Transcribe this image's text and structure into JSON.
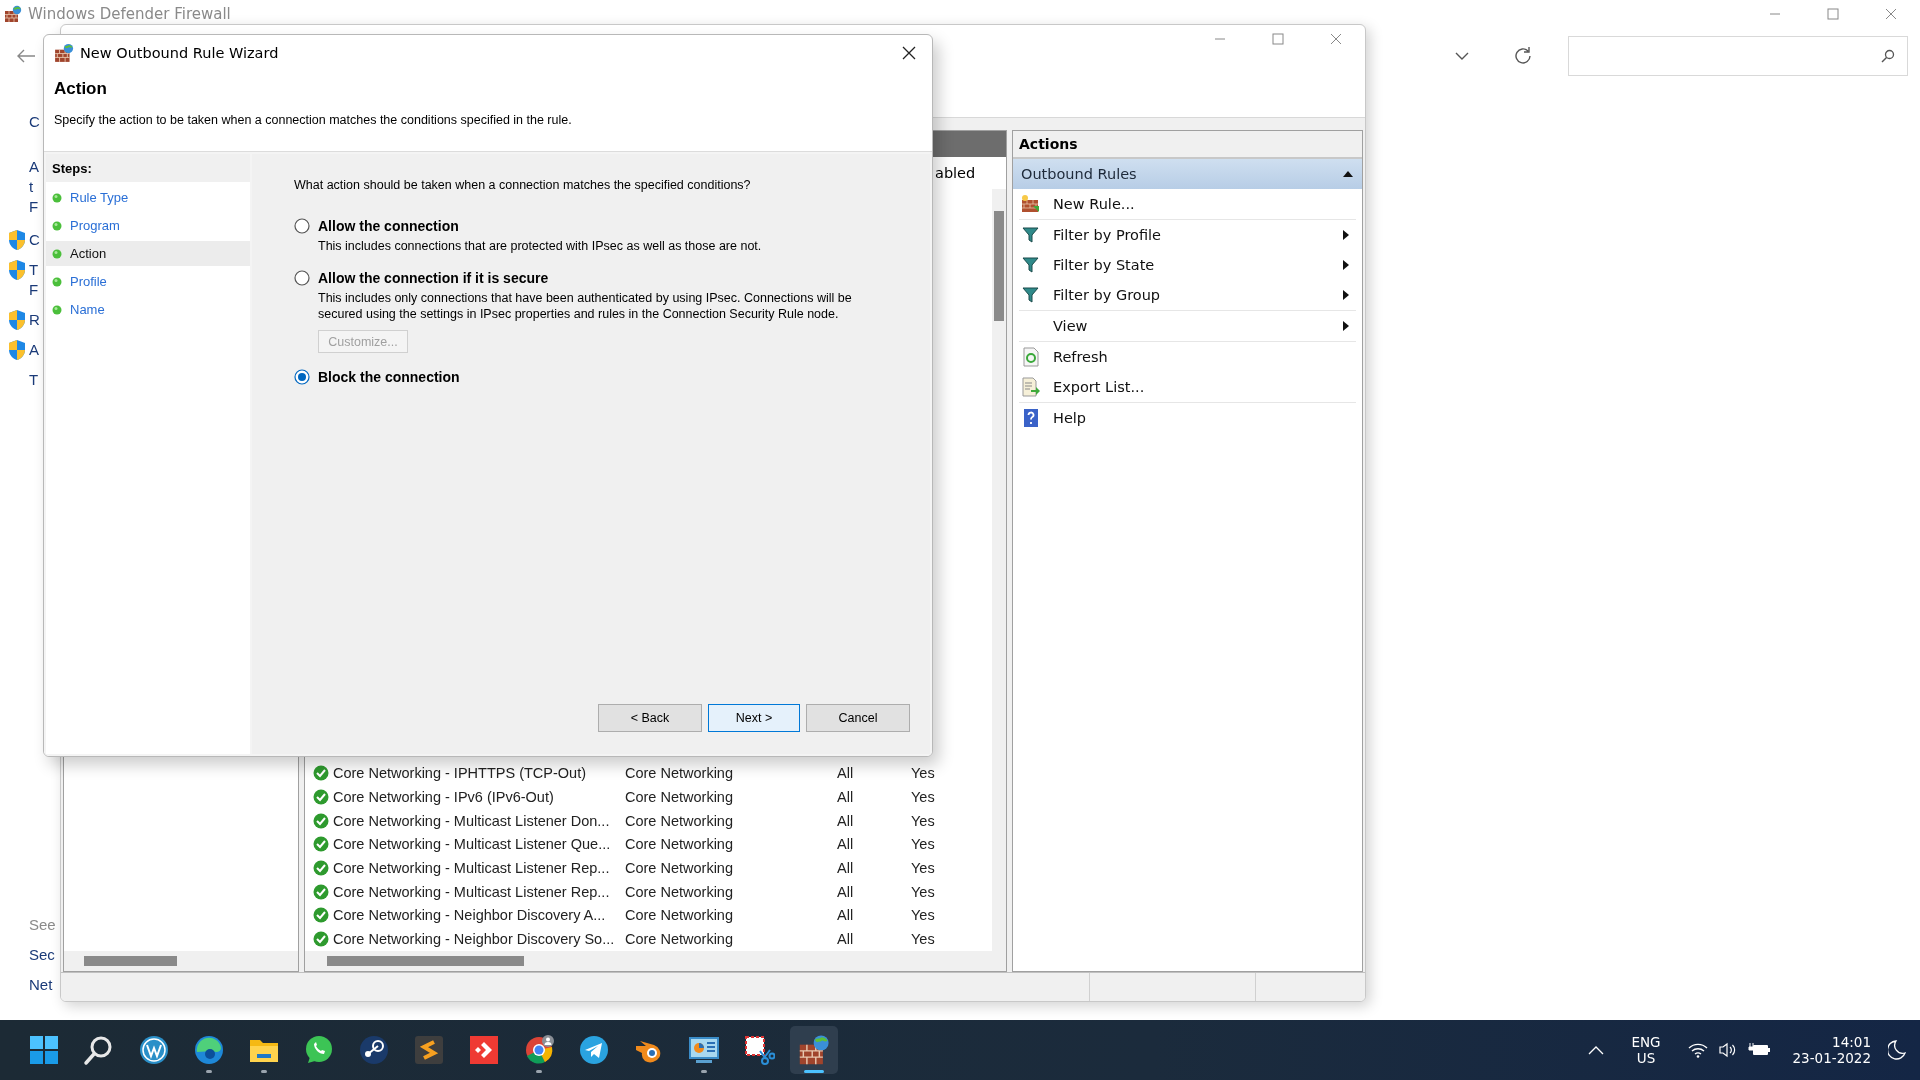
{
  "background_window": {
    "title": "Windows Defender Firewall",
    "left_links": [
      {
        "kind": "plain",
        "lines": [
          "C"
        ]
      },
      {
        "kind": "plain",
        "lines": [
          "A",
          "t",
          "F"
        ]
      },
      {
        "kind": "shield",
        "lines": [
          "C"
        ]
      },
      {
        "kind": "shield",
        "lines": [
          "T",
          "F"
        ]
      },
      {
        "kind": "shield",
        "lines": [
          "R"
        ]
      },
      {
        "kind": "shield",
        "lines": [
          "A"
        ]
      },
      {
        "kind": "plain",
        "lines": [
          "T"
        ]
      }
    ],
    "see_also": {
      "heading": "See",
      "links": [
        "Sec",
        "Net"
      ]
    }
  },
  "console_window": {
    "list_header": "abled",
    "rules": [
      {
        "name": "Core Networking - IPHTTPS (TCP-Out)",
        "group": "Core Networking",
        "profile": "All",
        "enabled": "Yes"
      },
      {
        "name": "Core Networking - IPv6 (IPv6-Out)",
        "group": "Core Networking",
        "profile": "All",
        "enabled": "Yes"
      },
      {
        "name": "Core Networking - Multicast Listener Don...",
        "group": "Core Networking",
        "profile": "All",
        "enabled": "Yes"
      },
      {
        "name": "Core Networking - Multicast Listener Que...",
        "group": "Core Networking",
        "profile": "All",
        "enabled": "Yes"
      },
      {
        "name": "Core Networking - Multicast Listener Rep...",
        "group": "Core Networking",
        "profile": "All",
        "enabled": "Yes"
      },
      {
        "name": "Core Networking - Multicast Listener Rep...",
        "group": "Core Networking",
        "profile": "All",
        "enabled": "Yes"
      },
      {
        "name": "Core Networking - Neighbor Discovery A...",
        "group": "Core Networking",
        "profile": "All",
        "enabled": "Yes"
      },
      {
        "name": "Core Networking - Neighbor Discovery So...",
        "group": "Core Networking",
        "profile": "All",
        "enabled": "Yes"
      }
    ],
    "actions": {
      "title": "Actions",
      "section": "Outbound Rules",
      "expanded": true,
      "groups": [
        [
          {
            "label": "New Rule...",
            "kind": "new-rule",
            "submenu": false
          }
        ],
        [
          {
            "label": "Filter by Profile",
            "kind": "filter",
            "submenu": true
          },
          {
            "label": "Filter by State",
            "kind": "filter",
            "submenu": true
          },
          {
            "label": "Filter by Group",
            "kind": "filter",
            "submenu": true
          }
        ],
        [
          {
            "label": "View",
            "kind": "none",
            "submenu": true
          }
        ],
        [
          {
            "label": "Refresh",
            "kind": "refresh",
            "submenu": false
          },
          {
            "label": "Export List...",
            "kind": "export",
            "submenu": false
          }
        ],
        [
          {
            "label": "Help",
            "kind": "help",
            "submenu": false
          }
        ]
      ]
    }
  },
  "wizard": {
    "title": "New Outbound Rule Wizard",
    "heading": "Action",
    "description": "Specify the action to be taken when a connection matches the conditions specified in the rule.",
    "steps_title": "Steps:",
    "steps": [
      {
        "label": "Rule Type",
        "selected": false
      },
      {
        "label": "Program",
        "selected": false
      },
      {
        "label": "Action",
        "selected": true
      },
      {
        "label": "Profile",
        "selected": false
      },
      {
        "label": "Name",
        "selected": false
      }
    ],
    "question": "What action should be taken when a connection matches the specified conditions?",
    "options": [
      {
        "label": "Allow the connection",
        "selected": false,
        "description": "This includes connections that are protected with IPsec as well as those are not."
      },
      {
        "label": "Allow the connection if it is secure",
        "selected": false,
        "description": "This includes only connections that have been authenticated by using IPsec.  Connections will be secured using the settings in IPsec properties and rules in the Connection Security Rule node.",
        "button": {
          "label": "Customize...",
          "disabled": true
        }
      },
      {
        "label": "Block the connection",
        "selected": true
      }
    ],
    "buttons": [
      {
        "label": "< Back",
        "default": false
      },
      {
        "label": "Next >",
        "default": true
      },
      {
        "label": "Cancel",
        "default": false
      }
    ]
  },
  "taskbar": {
    "apps": [
      {
        "kind": "grid",
        "running": false,
        "selected": false
      },
      {
        "kind": "search",
        "running": false,
        "selected": false
      },
      {
        "kind": "ring",
        "running": false,
        "selected": false
      },
      {
        "kind": "swirl",
        "running": true,
        "selected": false
      },
      {
        "kind": "folder",
        "running": true,
        "selected": false
      },
      {
        "kind": "chat",
        "running": false,
        "selected": false
      },
      {
        "kind": "dark-round",
        "running": false,
        "selected": false
      },
      {
        "kind": "stroke",
        "running": false,
        "selected": false
      },
      {
        "kind": "diamond",
        "running": false,
        "selected": false
      },
      {
        "kind": "tricolor",
        "running": true,
        "selected": false
      },
      {
        "kind": "plane",
        "running": false,
        "selected": false
      },
      {
        "kind": "eye",
        "running": false,
        "selected": false
      },
      {
        "kind": "monitor",
        "running": true,
        "selected": false
      },
      {
        "kind": "scissors",
        "running": false,
        "selected": false
      },
      {
        "kind": "wall",
        "running": true,
        "selected": true
      }
    ],
    "language": "ENG",
    "region": "US",
    "time": "14:01",
    "date": "23-01-2022"
  }
}
